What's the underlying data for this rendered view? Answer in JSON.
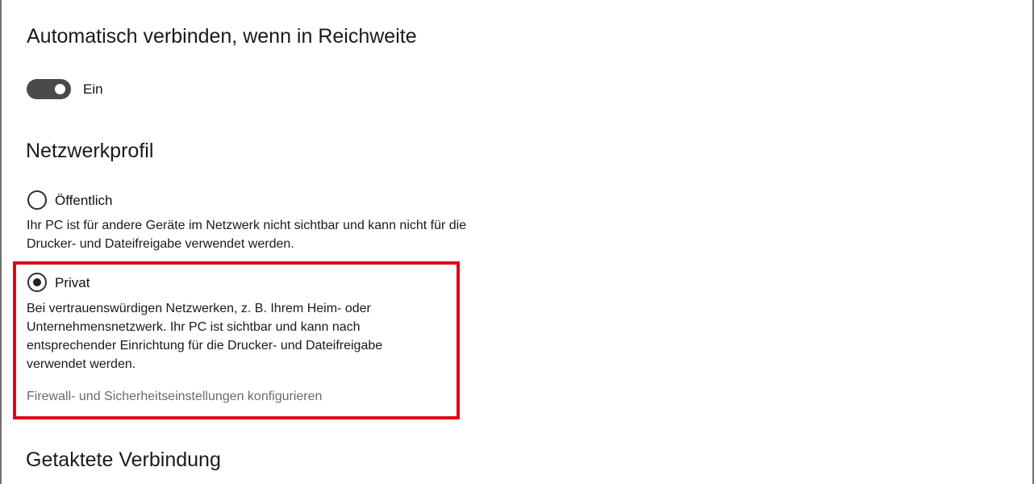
{
  "auto_connect": {
    "title": "Automatisch verbinden, wenn in Reichweite",
    "toggle_label": "Ein",
    "toggle_on": true
  },
  "network_profile": {
    "title": "Netzwerkprofil",
    "options": [
      {
        "label": "Öffentlich",
        "selected": false,
        "description": "Ihr PC ist für andere Geräte im Netzwerk nicht sichtbar und kann nicht für die Drucker- und Dateifreigabe verwendet werden."
      },
      {
        "label": "Privat",
        "selected": true,
        "description": "Bei vertrauenswürdigen Netzwerken, z. B. Ihrem Heim- oder Unternehmensnetzwerk. Ihr PC ist sichtbar und kann nach entsprechender Einrichtung für die Drucker- und Dateifreigabe verwendet werden."
      }
    ],
    "firewall_link": "Firewall- und Sicherheitseinstellungen konfigurieren"
  },
  "metered_connection": {
    "title": "Getaktete Verbindung"
  },
  "colors": {
    "highlight": "#e30613",
    "toggle_on": "#4a4a4a",
    "link": "#6b6b6b"
  }
}
